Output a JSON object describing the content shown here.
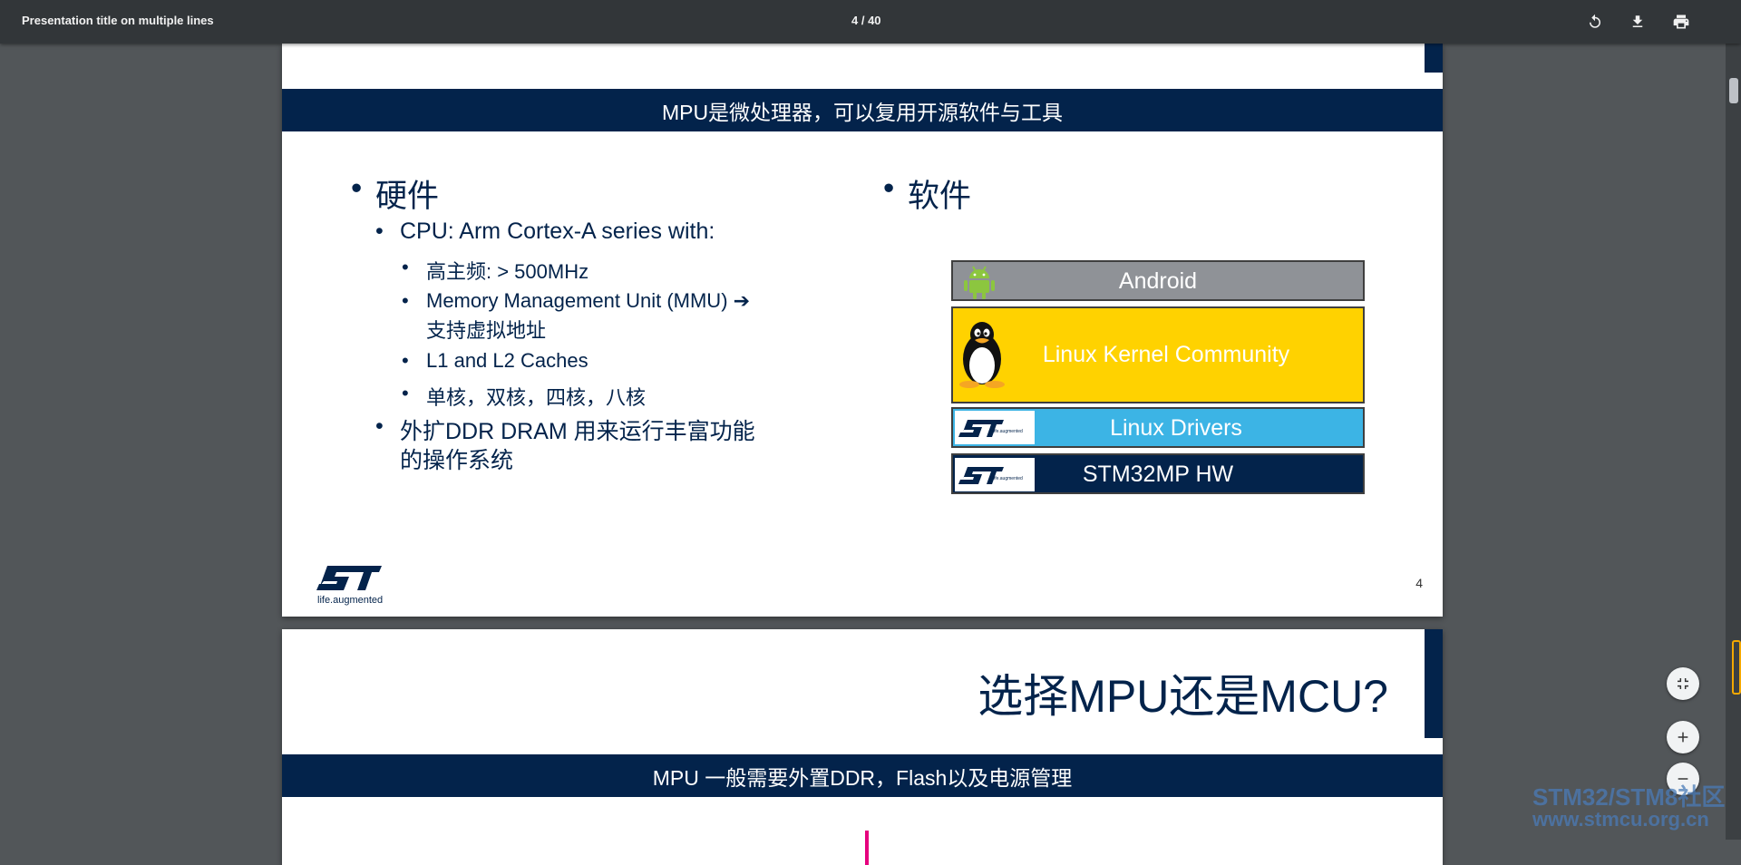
{
  "toolbar": {
    "title": "Presentation title on multiple lines",
    "page_indicator": "4 / 40",
    "icons": [
      "rotate-icon",
      "download-icon",
      "print-icon"
    ]
  },
  "slide4": {
    "header_band": "MPU是微处理器，可以复用开源软件与工具",
    "bullet": "•",
    "hardware": {
      "heading": "硬件",
      "cpu": "CPU: Arm Cortex-A series with:",
      "sub_items": [
        "高主频: > 500MHz",
        "Memory Management Unit (MMU)",
        "支持虚拟地址",
        "L1 and L2 Caches",
        "单核，双核，四核，八核"
      ],
      "arrow": "➔",
      "ddr_line1": "外扩DDR DRAM 用来运行丰富功能",
      "ddr_line2": "的操作系统"
    },
    "software": {
      "heading": "软件",
      "stack": [
        "Android",
        "Linux Kernel Community",
        "Linux Drivers",
        "STM32MP HW"
      ],
      "colors": {
        "android": "#8f9297",
        "kernel": "#ffd200",
        "drivers": "#3cb4e5",
        "hw": "#03234b"
      },
      "st_badge_caption": "life.augmented"
    },
    "logo_caption": "life.augmented",
    "page_number": "4"
  },
  "slide5": {
    "title": "选择MPU还是MCU?",
    "header_band": "MPU 一般需要外置DDR，Flash以及电源管理"
  },
  "watermark": {
    "line1": "STM32/STM8社区",
    "line2": "www.stmcu.org.cn"
  },
  "zoom_controls": [
    "fit-page-icon",
    "zoom-in-icon",
    "zoom-out-icon"
  ]
}
